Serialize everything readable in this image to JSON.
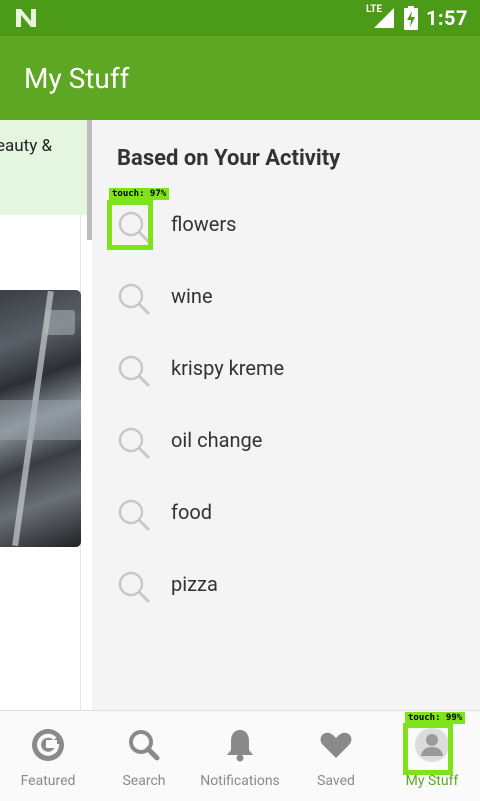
{
  "status_bar": {
    "network_label": "LTE",
    "time": "1:57",
    "icons": [
      "n-logo-icon",
      "signal-icon",
      "battery-charging-icon"
    ]
  },
  "app_bar": {
    "title": "My Stuff"
  },
  "left_panel": {
    "category_snippet": "eauty &"
  },
  "activity": {
    "heading": "Based on Your Activity",
    "items": [
      {
        "label": "flowers",
        "icon": "search-icon"
      },
      {
        "label": "wine",
        "icon": "search-icon"
      },
      {
        "label": "krispy kreme",
        "icon": "search-icon"
      },
      {
        "label": "oil change",
        "icon": "search-icon"
      },
      {
        "label": "food",
        "icon": "search-icon"
      },
      {
        "label": "pizza",
        "icon": "search-icon"
      }
    ]
  },
  "bottom_nav": {
    "items": [
      {
        "label": "Featured",
        "icon": "featured-g-icon"
      },
      {
        "label": "Search",
        "icon": "search-icon"
      },
      {
        "label": "Notifications",
        "icon": "bell-icon"
      },
      {
        "label": "Saved",
        "icon": "heart-icon"
      },
      {
        "label": "My Stuff",
        "icon": "person-icon",
        "active": true
      }
    ]
  },
  "overlays": [
    {
      "tag": "touch: 97%"
    },
    {
      "tag": "touch: 99%"
    }
  ],
  "colors": {
    "status_bar": "#4c9b18",
    "app_bar": "#5ea722",
    "active_nav": "#5ea722",
    "overlay": "#7ee31b",
    "card_highlight": "#e4f6df"
  }
}
